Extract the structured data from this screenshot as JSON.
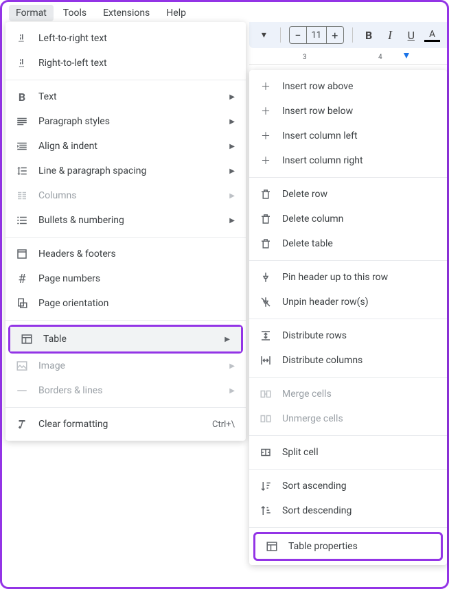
{
  "menubar": {
    "format": "Format",
    "tools": "Tools",
    "extensions": "Extensions",
    "help": "Help"
  },
  "toolbar": {
    "font_size": "11"
  },
  "ruler": {
    "t3": "3",
    "t4": "4"
  },
  "format_menu": {
    "ltr": "Left-to-right text",
    "rtl": "Right-to-left text",
    "text": "Text",
    "paragraph": "Paragraph styles",
    "align": "Align & indent",
    "line_spacing": "Line & paragraph spacing",
    "columns": "Columns",
    "bullets": "Bullets & numbering",
    "headers": "Headers & footers",
    "page_numbers": "Page numbers",
    "orientation": "Page orientation",
    "table": "Table",
    "image": "Image",
    "borders": "Borders & lines",
    "clear": "Clear formatting",
    "clear_shortcut": "Ctrl+\\"
  },
  "table_menu": {
    "insert_row_above": "Insert row above",
    "insert_row_below": "Insert row below",
    "insert_col_left": "Insert column left",
    "insert_col_right": "Insert column right",
    "delete_row": "Delete row",
    "delete_column": "Delete column",
    "delete_table": "Delete table",
    "pin_header": "Pin header up to this row",
    "unpin_header": "Unpin header row(s)",
    "distribute_rows": "Distribute rows",
    "distribute_cols": "Distribute columns",
    "merge": "Merge cells",
    "unmerge": "Unmerge cells",
    "split": "Split cell",
    "sort_asc": "Sort ascending",
    "sort_desc": "Sort descending",
    "props": "Table properties"
  }
}
